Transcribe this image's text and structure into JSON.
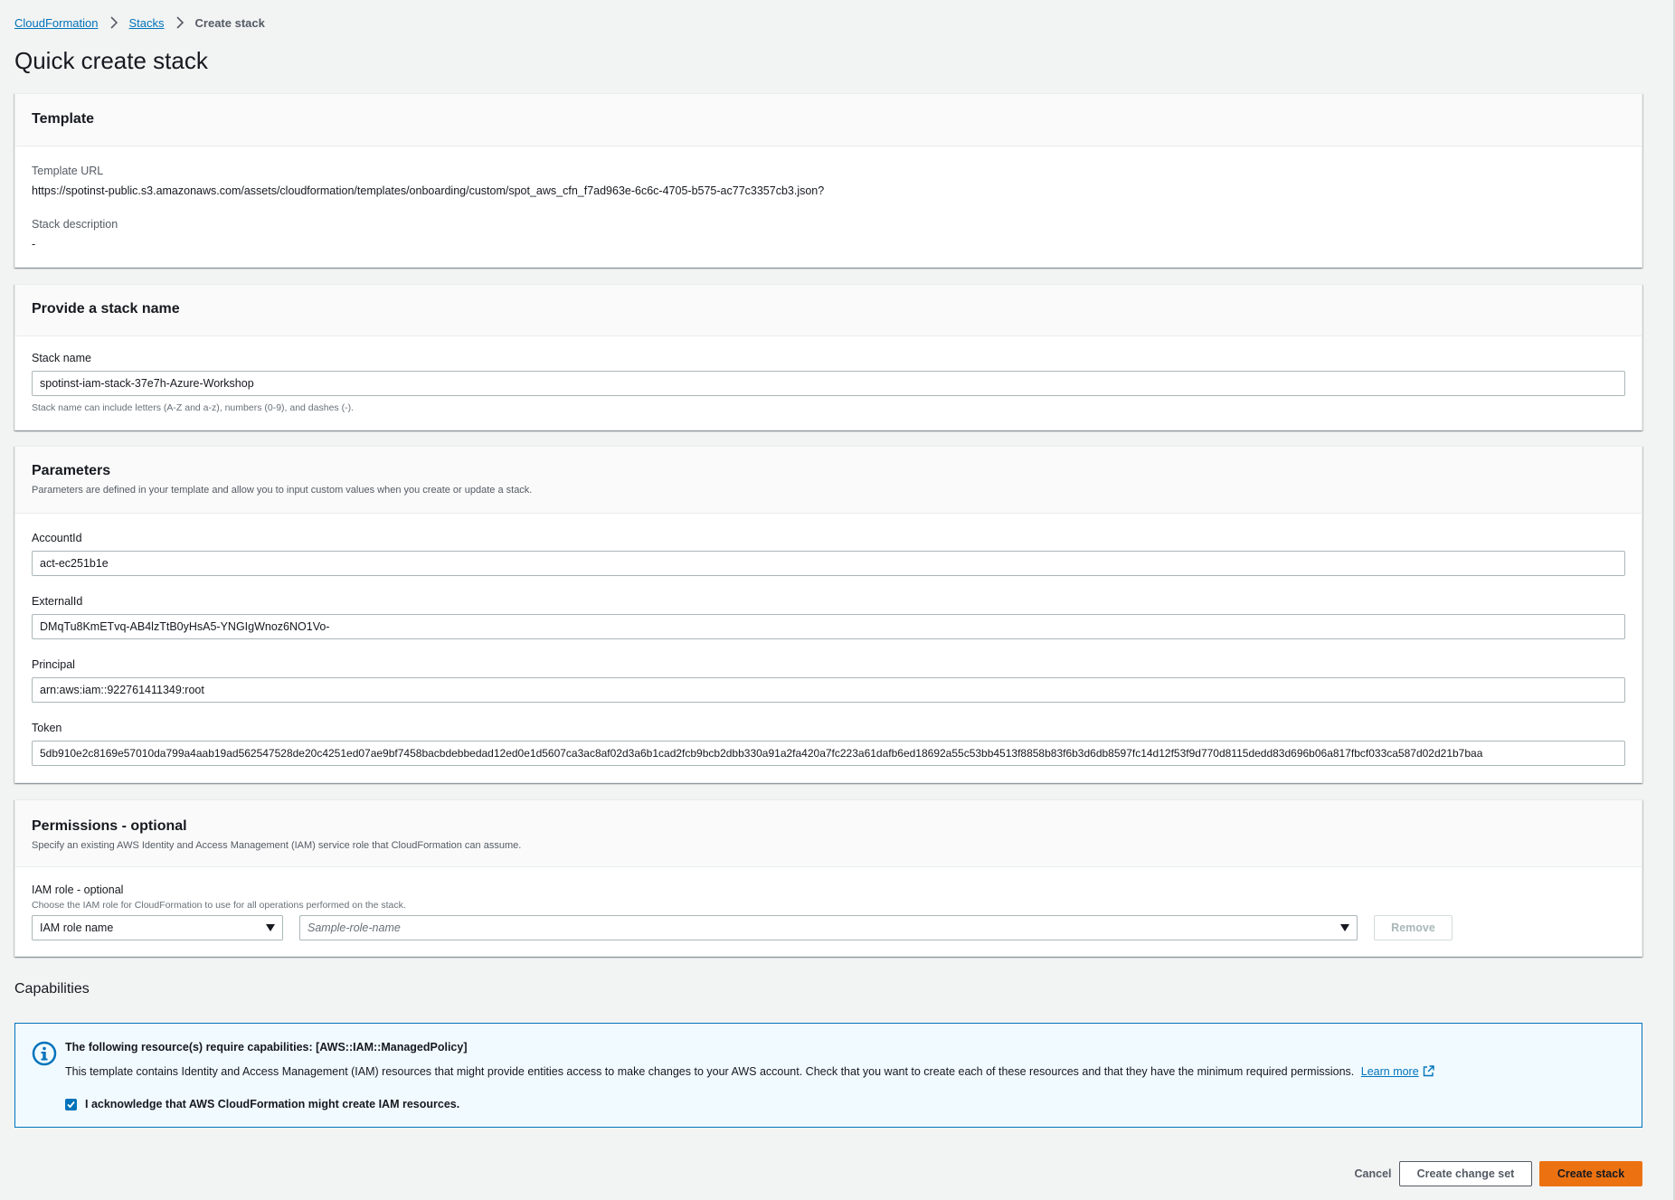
{
  "breadcrumb": {
    "items": [
      "CloudFormation",
      "Stacks"
    ],
    "current": "Create stack"
  },
  "page_title": "Quick create stack",
  "template_panel": {
    "title": "Template",
    "url_label": "Template URL",
    "url_value": "https://spotinst-public.s3.amazonaws.com/assets/cloudformation/templates/onboarding/custom/spot_aws_cfn_f7ad963e-6c6c-4705-b575-ac77c3357cb3.json?",
    "description_label": "Stack description",
    "description_value": "-"
  },
  "stack_name_panel": {
    "title": "Provide a stack name",
    "label": "Stack name",
    "value": "spotinst-iam-stack-37e7h-Azure-Workshop",
    "hint": "Stack name can include letters (A-Z and a-z), numbers (0-9), and dashes (-)."
  },
  "parameters_panel": {
    "title": "Parameters",
    "description": "Parameters are defined in your template and allow you to input custom values when you create or update a stack.",
    "fields": [
      {
        "label": "AccountId",
        "value": "act-ec251b1e"
      },
      {
        "label": "ExternalId",
        "value": "DMqTu8KmETvq-AB4lzTtB0yHsA5-YNGIgWnoz6NO1Vo-"
      },
      {
        "label": "Principal",
        "value": "arn:aws:iam::922761411349:root"
      },
      {
        "label": "Token",
        "value": "5db910e2c8169e57010da799a4aab19ad562547528de20c4251ed07ae9bf7458bacbdebbedad12ed0e1d5607ca3ac8af02d3a6b1cad2fcb9bcb2dbb330a91a2fa420a7fc223a61dafb6ed18692a55c53bb4513f8858b83f6b3d6db8597fc14d12f53f9d770d8115dedd83d696b06a817fbcf033ca587d02d21b7baa"
      }
    ]
  },
  "permissions_panel": {
    "title": "Permissions - optional",
    "description": "Specify an existing AWS Identity and Access Management (IAM) service role that CloudFormation can assume.",
    "role_label": "IAM role - optional",
    "role_hint": "Choose the IAM role for CloudFormation to use for all operations performed on the stack.",
    "role_type_selected": "IAM role name",
    "role_name_placeholder": "Sample-role-name",
    "remove_label": "Remove"
  },
  "capabilities": {
    "heading": "Capabilities",
    "alert_title": "The following resource(s) require capabilities: [AWS::IAM::ManagedPolicy]",
    "alert_text": "This template contains Identity and Access Management (IAM) resources that might provide entities access to make changes to your AWS account. Check that you want to create each of these resources and that they have the minimum required permissions.",
    "learn_more": "Learn more",
    "acknowledge_label": "I acknowledge that AWS CloudFormation might create IAM resources.",
    "acknowledged": true
  },
  "footer": {
    "cancel_label": "Cancel",
    "change_set_label": "Create change set",
    "create_label": "Create stack"
  },
  "colors": {
    "link": "#0073bb",
    "primary_button": "#ec7211",
    "background": "#f2f3f3",
    "info_alert_bg": "#f1faff"
  },
  "icons": [
    "chevron-right-icon",
    "info-icon",
    "caret-down-icon",
    "external-link-icon",
    "check-icon"
  ]
}
